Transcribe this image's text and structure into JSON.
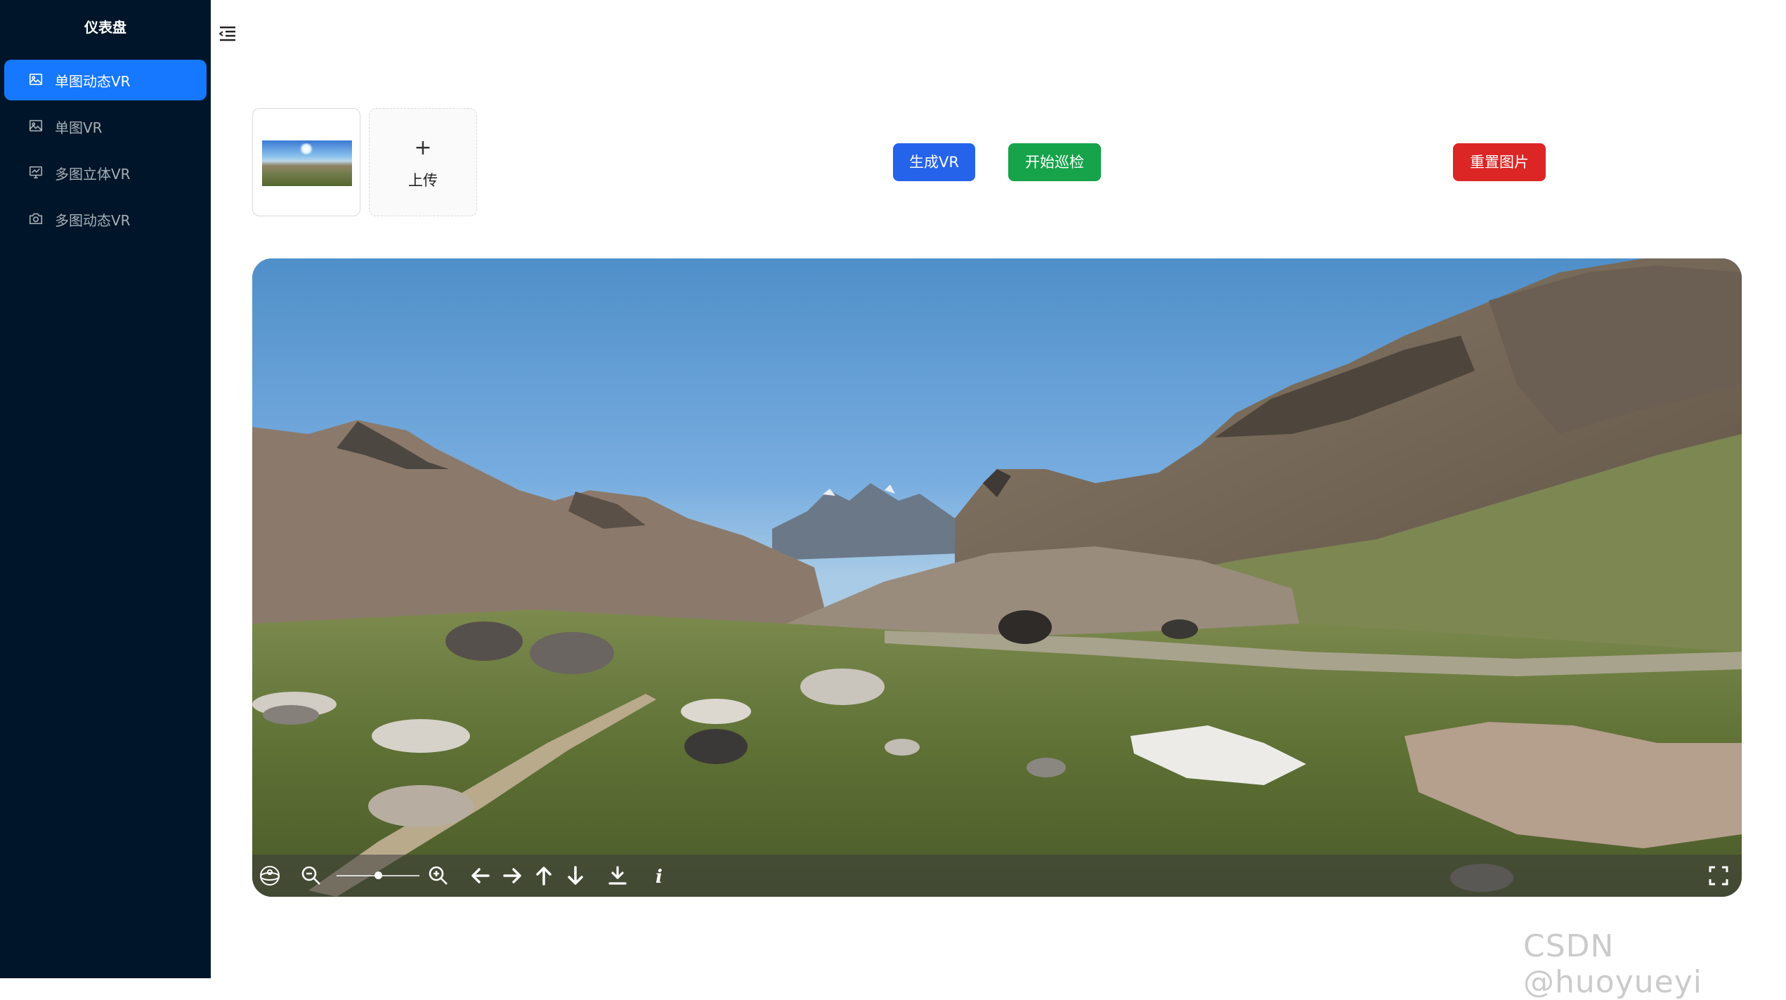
{
  "sidebar": {
    "title": "仪表盘",
    "items": [
      {
        "label": "单图动态VR",
        "icon": "picture-icon",
        "active": true
      },
      {
        "label": "单图VR",
        "icon": "picture-icon",
        "active": false
      },
      {
        "label": "多图立体VR",
        "icon": "fund-icon",
        "active": false
      },
      {
        "label": "多图动态VR",
        "icon": "camera-icon",
        "active": false
      }
    ]
  },
  "header": {
    "collapse_icon": "menu-fold-icon"
  },
  "upload": {
    "plus": "+",
    "label": "上传"
  },
  "actions": {
    "generate_label": "生成VR",
    "patrol_label": "开始巡检",
    "reset_label": "重置图片",
    "colors": {
      "generate": "#2563eb",
      "patrol": "#16a34a",
      "reset": "#dc2626"
    }
  },
  "viewer": {
    "navbar_icons": [
      "auto-rotate-icon",
      "zoom-out-icon",
      "zoom-in-icon",
      "arrow-left-icon",
      "arrow-right-icon",
      "arrow-up-icon",
      "arrow-down-icon",
      "download-icon",
      "info-icon",
      "fullscreen-icon"
    ],
    "zoom_level": 0.5
  },
  "watermark": "CSDN @huoyueyi"
}
